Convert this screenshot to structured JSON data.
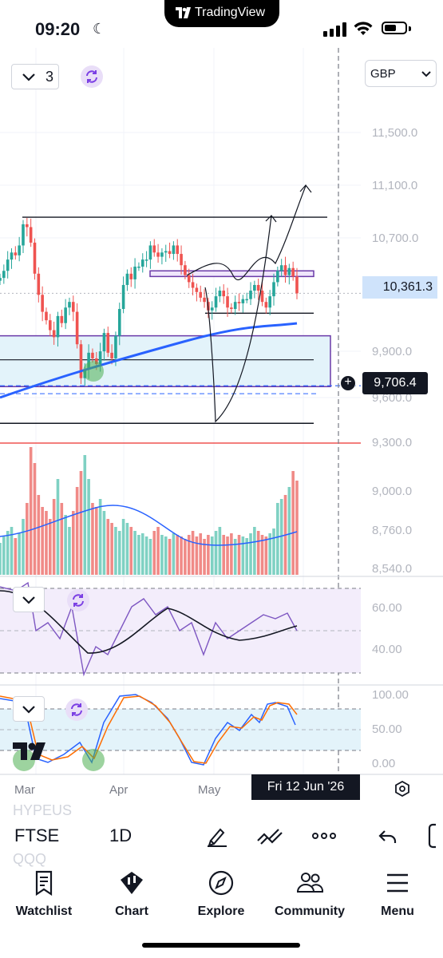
{
  "status_bar": {
    "time": "09:20"
  },
  "app": {
    "name": "TradingView"
  },
  "chart_header": {
    "interval_count": "3",
    "currency": "GBP"
  },
  "price_axis": {
    "ticks": [
      "11,500.0",
      "11,100.0",
      "10,700.0",
      "9,900.0",
      "9,600.0",
      "9,300.0",
      "9,000.0",
      "8,760.0",
      "8,540.0"
    ]
  },
  "price_labels": {
    "last_price": "10,361.3",
    "crosshair_price": "9,706.4"
  },
  "rsi_axis": {
    "ticks": [
      "60.00",
      "40.00"
    ]
  },
  "stoch_axis": {
    "ticks": [
      "100.00",
      "50.00",
      "0.00"
    ]
  },
  "time_axis": {
    "ticks": [
      "Mar",
      "Apr",
      "May"
    ],
    "crosshair_date": "Fri 12 Jun '26"
  },
  "toolbar": {
    "symbol": "FTSE",
    "interval": "1D",
    "ghost_top": "HYPEUS",
    "ghost_bottom": "QQQ"
  },
  "nav": {
    "items": [
      {
        "label": "Watchlist",
        "icon": "watchlist-icon"
      },
      {
        "label": "Chart",
        "icon": "chart-icon"
      },
      {
        "label": "Explore",
        "icon": "compass-icon"
      },
      {
        "label": "Community",
        "icon": "community-icon"
      },
      {
        "label": "Menu",
        "icon": "menu-icon"
      }
    ]
  },
  "colors": {
    "up": "#26a69a",
    "down": "#ef5350",
    "ma": "#2962ff",
    "rsi": "#7e57c2",
    "stoch_k": "#2962ff",
    "stoch_d": "#ff6d00",
    "accent": "#131722"
  },
  "chart_data": {
    "type": "candlestick",
    "symbol": "FTSE",
    "interval": "1D",
    "x_ticks": [
      "Mar",
      "Apr",
      "May"
    ],
    "y_ticks": [
      11500,
      11100,
      10700,
      9900,
      9600,
      9300
    ],
    "ylim": [
      9100,
      11800
    ],
    "close_path": [
      10470,
      10520,
      10600,
      10650,
      10630,
      10700,
      10850,
      10830,
      10720,
      10500,
      10350,
      10230,
      10170,
      10100,
      10050,
      10200,
      10150,
      10260,
      10300,
      10230,
      10000,
      9760,
      9820,
      9940,
      9900,
      9860,
      9950,
      10080,
      9940,
      9900,
      10060,
      10250,
      10420,
      10500,
      10460,
      10550,
      10550,
      10600,
      10600,
      10700,
      10650,
      10620,
      10650,
      10660,
      10640,
      10700,
      10640,
      10560,
      10490,
      10440,
      10400,
      10370,
      10330,
      10300,
      10240,
      10260,
      10340,
      10380,
      10340,
      10260,
      10250,
      10300,
      10290,
      10320,
      10320,
      10380,
      10420,
      10380,
      10300,
      10260,
      10340,
      10440,
      10520,
      10560,
      10490,
      10540,
      10480,
      10361
    ],
    "last_price": 10361.3,
    "crosshair_price": 9706.4,
    "volume_ylim": [
      8540,
      9300
    ],
    "rsi_levels": [
      60,
      40
    ],
    "stoch_levels": [
      100,
      50,
      0
    ],
    "crosshair_date": "Fri 12 Jun '26"
  }
}
